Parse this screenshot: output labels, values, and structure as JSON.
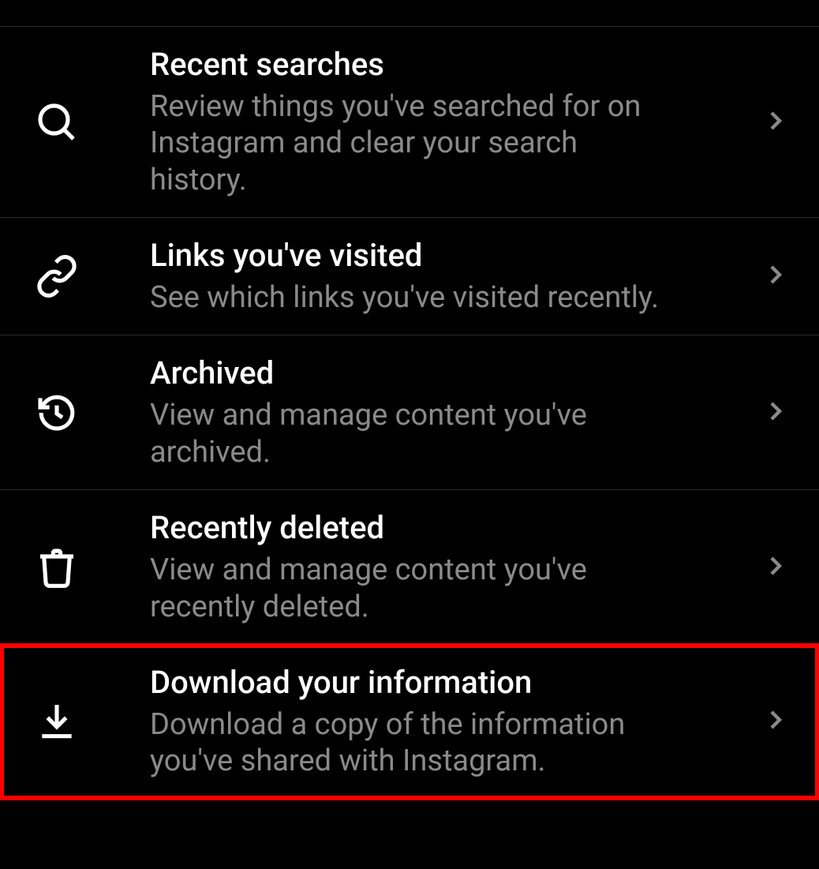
{
  "items": [
    {
      "title": "Recent searches",
      "subtitle": "Review things you've searched for on Instagram and clear your search history.",
      "icon": "search-icon"
    },
    {
      "title": "Links you've visited",
      "subtitle": "See which links you've visited recently.",
      "icon": "link-icon"
    },
    {
      "title": "Archived",
      "subtitle": "View and manage content you've archived.",
      "icon": "archive-icon"
    },
    {
      "title": "Recently deleted",
      "subtitle": "View and manage content you've recently deleted.",
      "icon": "trash-icon"
    },
    {
      "title": "Download your information",
      "subtitle": "Download a copy of the information you've shared with Instagram.",
      "icon": "download-icon"
    }
  ],
  "highlighted_index": 4
}
